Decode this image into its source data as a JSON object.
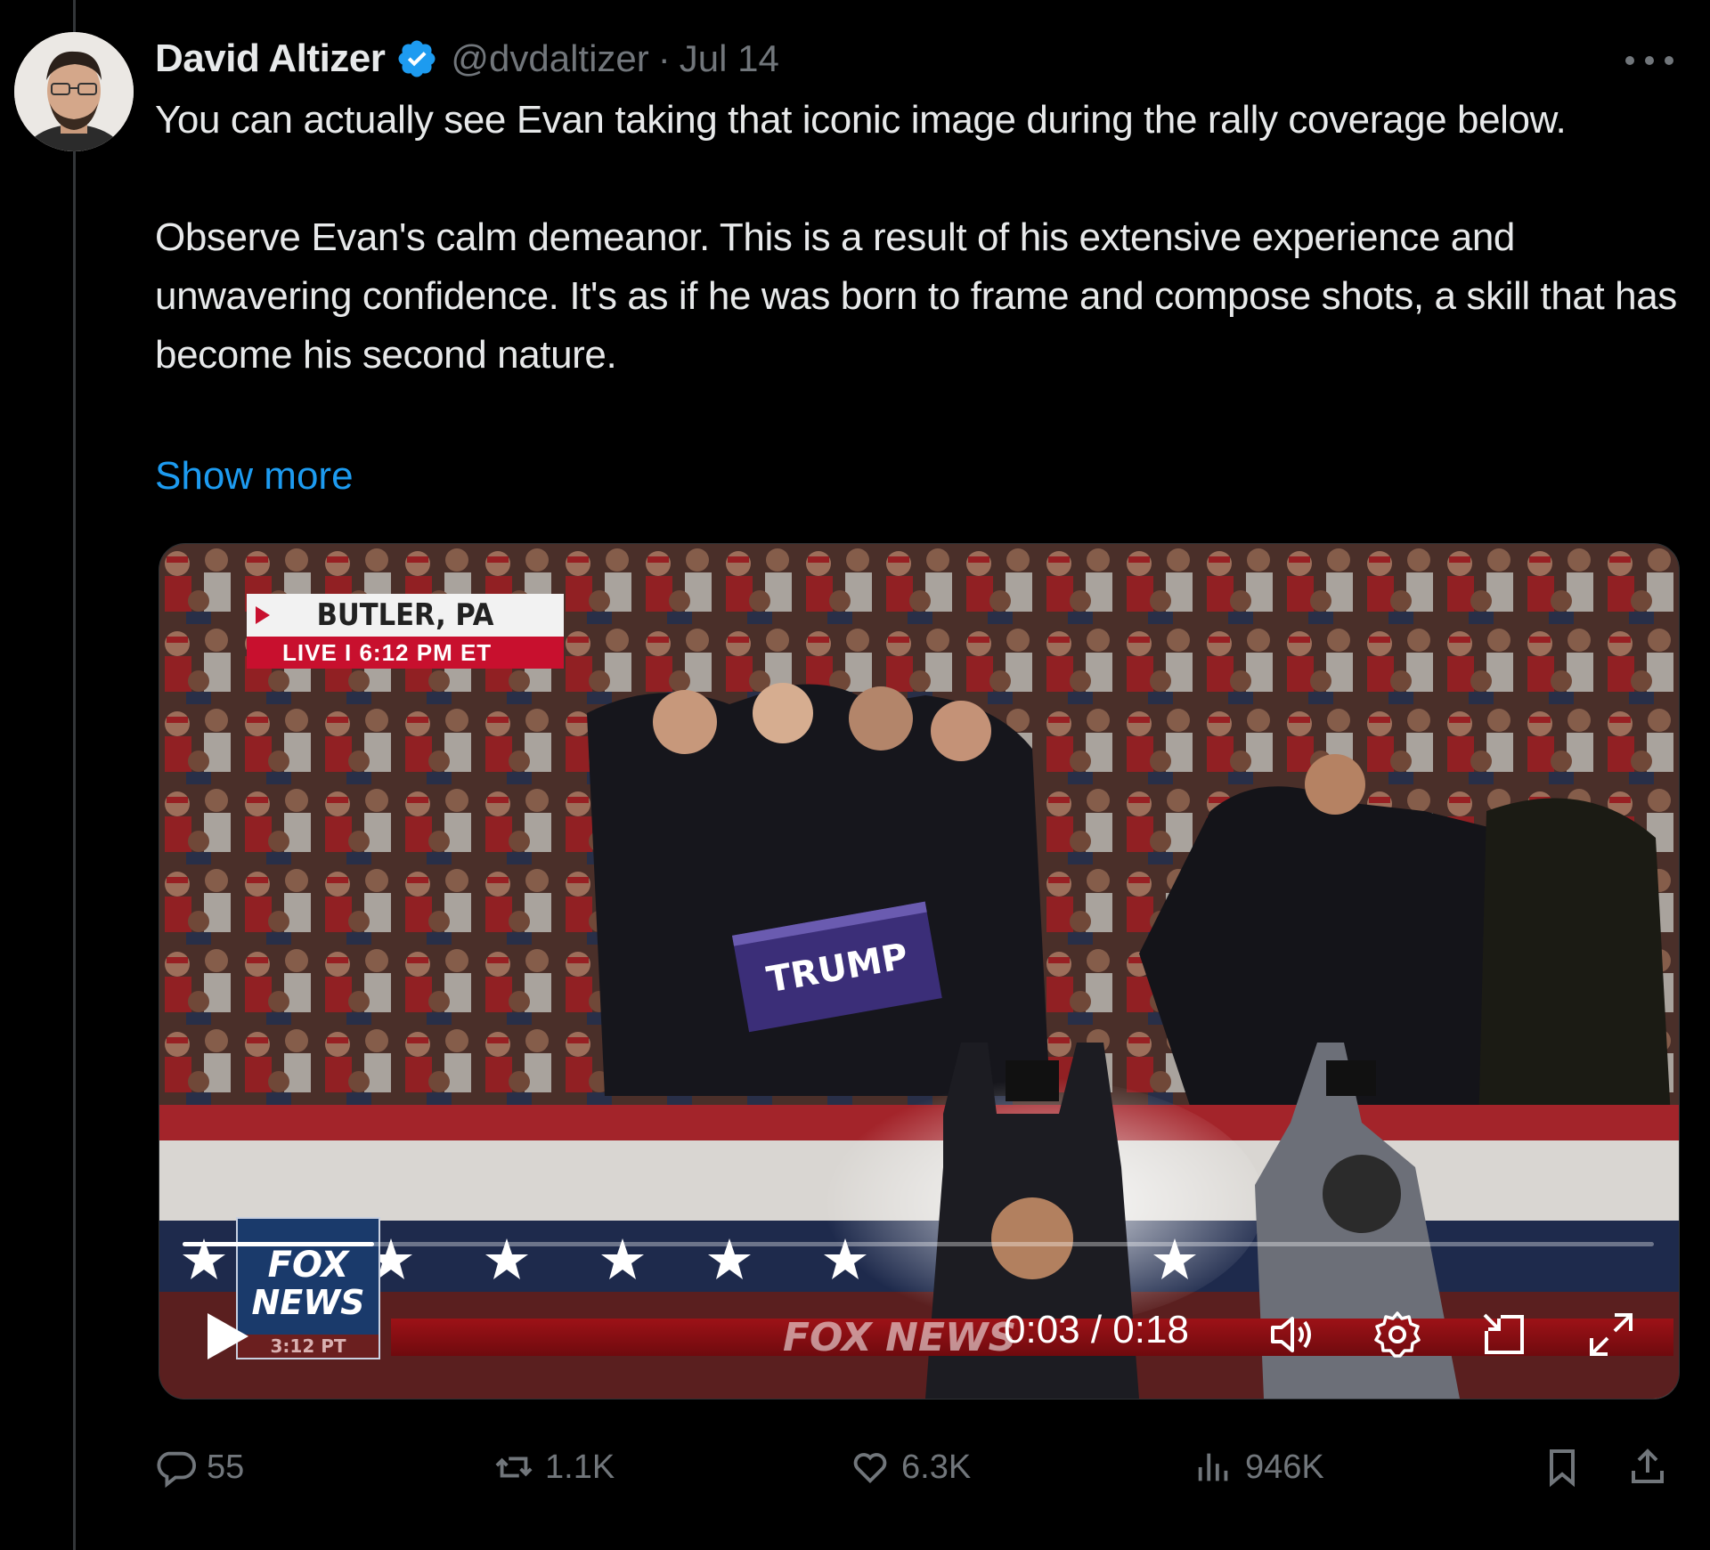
{
  "tweet": {
    "author": {
      "display_name": "David Altizer",
      "verified": true,
      "handle": "@dvdaltizer",
      "separator": "·",
      "date": "Jul 14"
    },
    "text": {
      "paragraph1": "You can actually see Evan taking that iconic image during the rally coverage below.",
      "paragraph2": "Observe Evan's calm demeanor. This is a result of his extensive experience and unwavering confidence. It's as if he was born to frame and compose shots, a skill that has become his second nature."
    },
    "show_more_label": "Show more",
    "media": {
      "type": "video",
      "overlay": {
        "location": "BUTLER, PA",
        "live_line": "LIVE I 6:12 PM ET",
        "sign_text": "TRUMP",
        "fox_logo_line1": "FOX",
        "fox_logo_line2": "NEWS",
        "fox_logo_time": "3:12 PT",
        "ticker_text": "FOX NEWS"
      },
      "player": {
        "elapsed": "0:03",
        "duration": "0:18",
        "time_label": "0:03 / 0:18",
        "progress": 0.13,
        "controls": [
          "play-icon",
          "volume-icon",
          "settings-gear-icon",
          "pip-icon",
          "fullscreen-icon"
        ]
      }
    },
    "actions": {
      "replies": "55",
      "reposts": "1.1K",
      "likes": "6.3K",
      "views": "946K"
    }
  },
  "colors": {
    "background": "#000000",
    "primary_text": "#e7e9ea",
    "secondary_text": "#71767b",
    "link": "#1d9bf0",
    "verified": "#1d9bf0"
  }
}
